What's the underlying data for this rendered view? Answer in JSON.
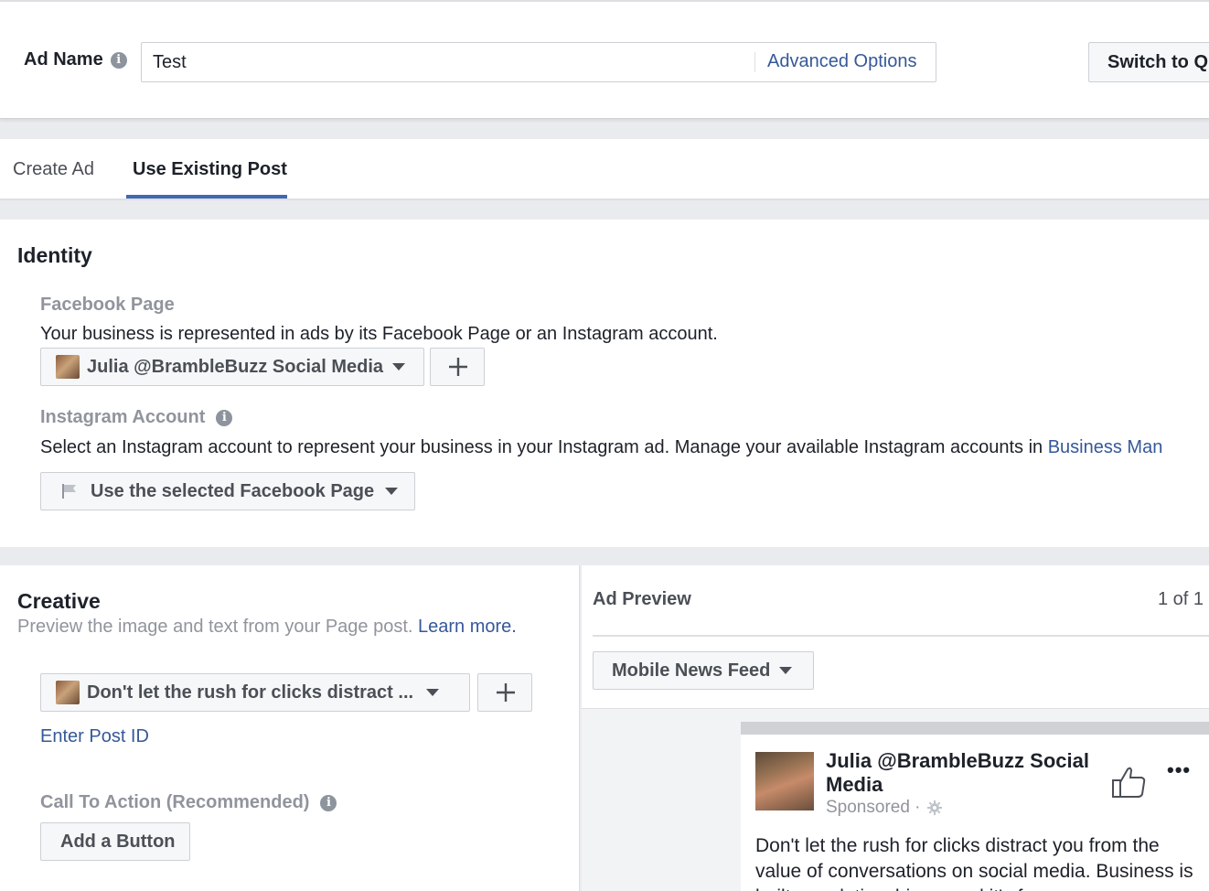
{
  "header": {
    "ad_name_label": "Ad Name",
    "ad_name_value": "Test",
    "advanced_options": "Advanced Options",
    "switch_label": "Switch to Qu"
  },
  "tabs": [
    {
      "label": "Create Ad",
      "active": false
    },
    {
      "label": "Use Existing Post",
      "active": true
    }
  ],
  "identity": {
    "title": "Identity",
    "facebook_page_label": "Facebook Page",
    "facebook_page_desc": "Your business is represented in ads by its Facebook Page or an Instagram account.",
    "page_selected": "Julia @BrambleBuzz Social Media",
    "instagram_label": "Instagram Account",
    "instagram_desc": "Select an Instagram account to represent your business in your Instagram ad. Manage your available Instagram accounts in",
    "instagram_link": "Business Man",
    "instagram_selected": "Use the selected Facebook Page"
  },
  "creative": {
    "title": "Creative",
    "subtitle": "Preview the image and text from your Page post.",
    "learn_more": "Learn more.",
    "post_selected": "Don't let the rush for clicks distract ...",
    "enter_post_id": "Enter Post ID",
    "cta_label": "Call To Action (Recommended)",
    "add_button": "Add a Button"
  },
  "preview": {
    "title": "Ad Preview",
    "count": "1 of 1",
    "placement": "Mobile News Feed",
    "post_name": "Julia @BrambleBuzz Social Media",
    "sponsored": "Sponsored ·",
    "post_text": "Don't let the rush for clicks distract you from the value of conversations on social media. Business is built on relationships... and it's for"
  },
  "colors": {
    "link": "#365899",
    "tab_active": "#4267b2",
    "muted": "#90949c",
    "background": "#e9ebee"
  }
}
